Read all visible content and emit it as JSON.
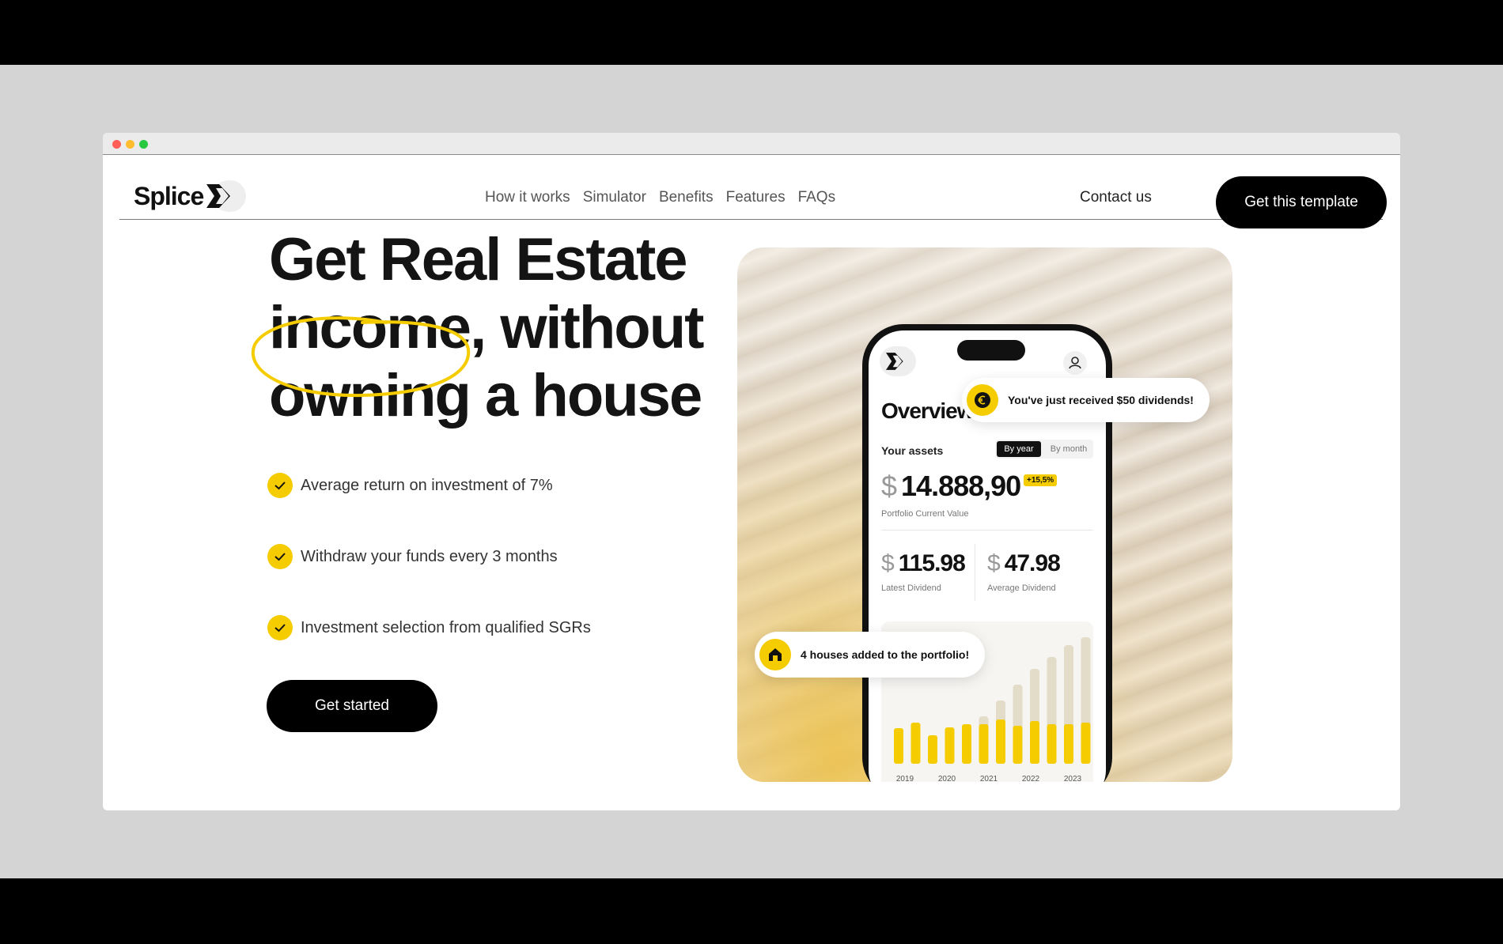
{
  "nav": {
    "brand": "Splice",
    "links": [
      "How it works",
      "Simulator",
      "Benefits",
      "Features",
      "FAQs"
    ],
    "contact": "Contact us",
    "cta": "Get this template"
  },
  "hero": {
    "line1": "Get Real Estate",
    "line2_highlight": "income,",
    "line2_rest": " without",
    "line3": "owning a house",
    "features": [
      "Average return on investment of 7%",
      "Withdraw your funds every 3 months",
      "Investment selection from qualified SGRs"
    ],
    "cta": "Get started"
  },
  "app": {
    "title": "Overview",
    "assets_label": "Your assets",
    "toggle": {
      "active": "By year",
      "inactive": "By month"
    },
    "currency": "$",
    "portfolio_value": "14.888,90",
    "portfolio_change": "+15,5%",
    "portfolio_label": "Portfolio Current Value",
    "latest_dividend": "115.98",
    "latest_dividend_label": "Latest Dividend",
    "average_dividend": "47.98",
    "average_dividend_label": "Average Dividend",
    "chart_years": [
      "2019",
      "2020",
      "2021",
      "2022",
      "2023"
    ],
    "notifications": {
      "dividends": "You've just received $50 dividends!",
      "houses": "4 houses added to the portfolio!"
    }
  },
  "colors": {
    "accent": "#f5cc00",
    "dark": "#000000"
  }
}
